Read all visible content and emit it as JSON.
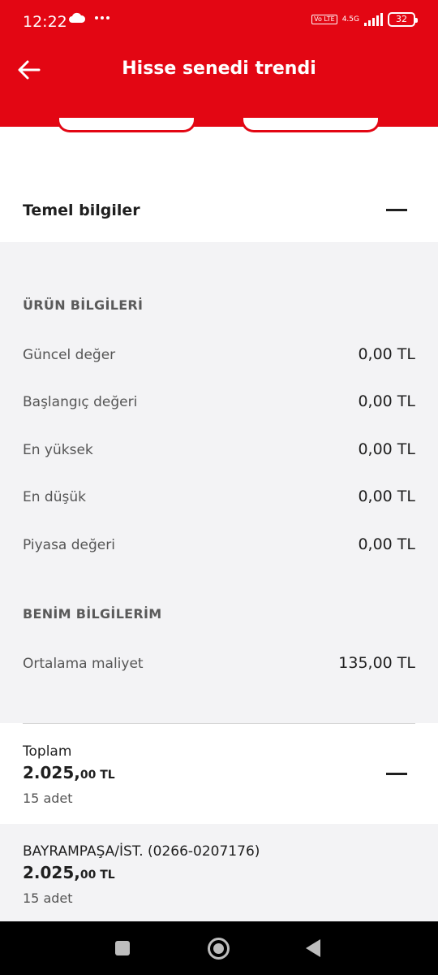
{
  "status_bar": {
    "time": "12:22",
    "volte": "Vo LTE",
    "network": "4.5G",
    "battery": "32"
  },
  "header": {
    "title": "Hisse senedi trendi"
  },
  "basic_info": {
    "section_title": "Temel bilgiler",
    "product_group_label": "ÜRÜN BİLGİLERİ",
    "product_rows": [
      {
        "label": "Güncel değer",
        "value": "0,00 TL"
      },
      {
        "label": "Başlangıç değeri",
        "value": "0,00 TL"
      },
      {
        "label": "En yüksek",
        "value": "0,00 TL"
      },
      {
        "label": "En düşük",
        "value": "0,00 TL"
      },
      {
        "label": "Piyasa değeri",
        "value": "0,00 TL"
      }
    ],
    "my_group_label": "BENİM BİLGİLERİM",
    "my_rows": [
      {
        "label": "Ortalama maliyet",
        "value": "135,00 TL"
      }
    ]
  },
  "total": {
    "title": "Toplam",
    "amount_main": "2.025,",
    "amount_frac": "00 TL",
    "quantity": "15 adet"
  },
  "branch": {
    "title": "BAYRAMPAŞA/İST. (0266-0207176)",
    "amount_main": "2.025,",
    "amount_frac": "00 TL",
    "quantity": "15 adet"
  },
  "colors": {
    "brand": "#e30613",
    "panel": "#f3f3f5"
  }
}
